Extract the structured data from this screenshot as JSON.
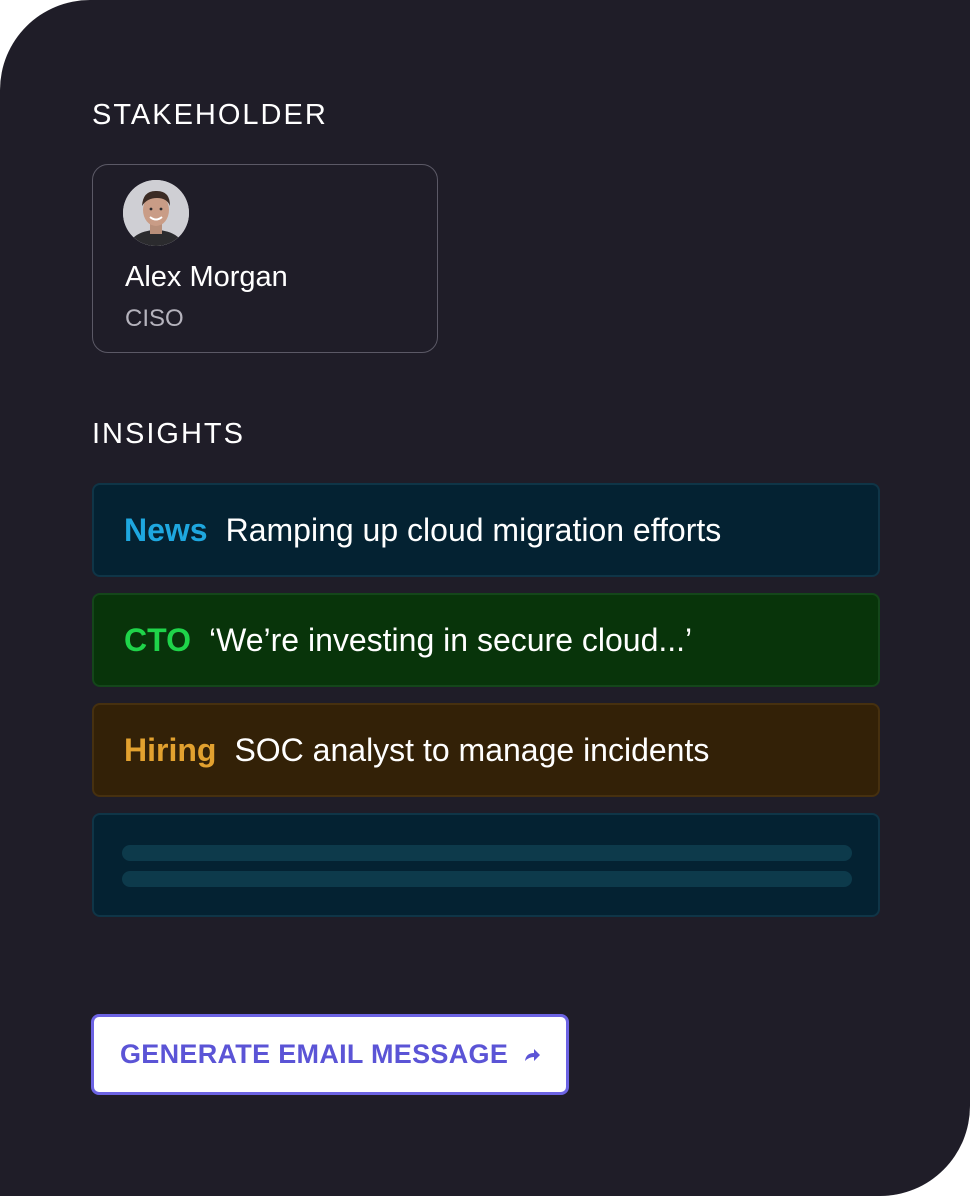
{
  "stakeholder": {
    "section_label": "STAKEHOLDER",
    "name": "Alex Morgan",
    "role": "CISO"
  },
  "insights": {
    "section_label": "INSIGHTS",
    "items": [
      {
        "tag": "News",
        "text": "Ramping up cloud migration efforts",
        "tag_color": "#1ea7df"
      },
      {
        "tag": "CTO",
        "text": "‘We’re investing in secure cloud...’",
        "tag_color": "#1fd44a"
      },
      {
        "tag": "Hiring",
        "text": "SOC analyst to manage incidents",
        "tag_color": "#e2a12f"
      }
    ]
  },
  "action": {
    "label": "GENERATE EMAIL MESSAGE",
    "icon": "share-arrow-icon",
    "accent_color": "#5b54d6"
  },
  "colors": {
    "background": "#1f1d28"
  }
}
